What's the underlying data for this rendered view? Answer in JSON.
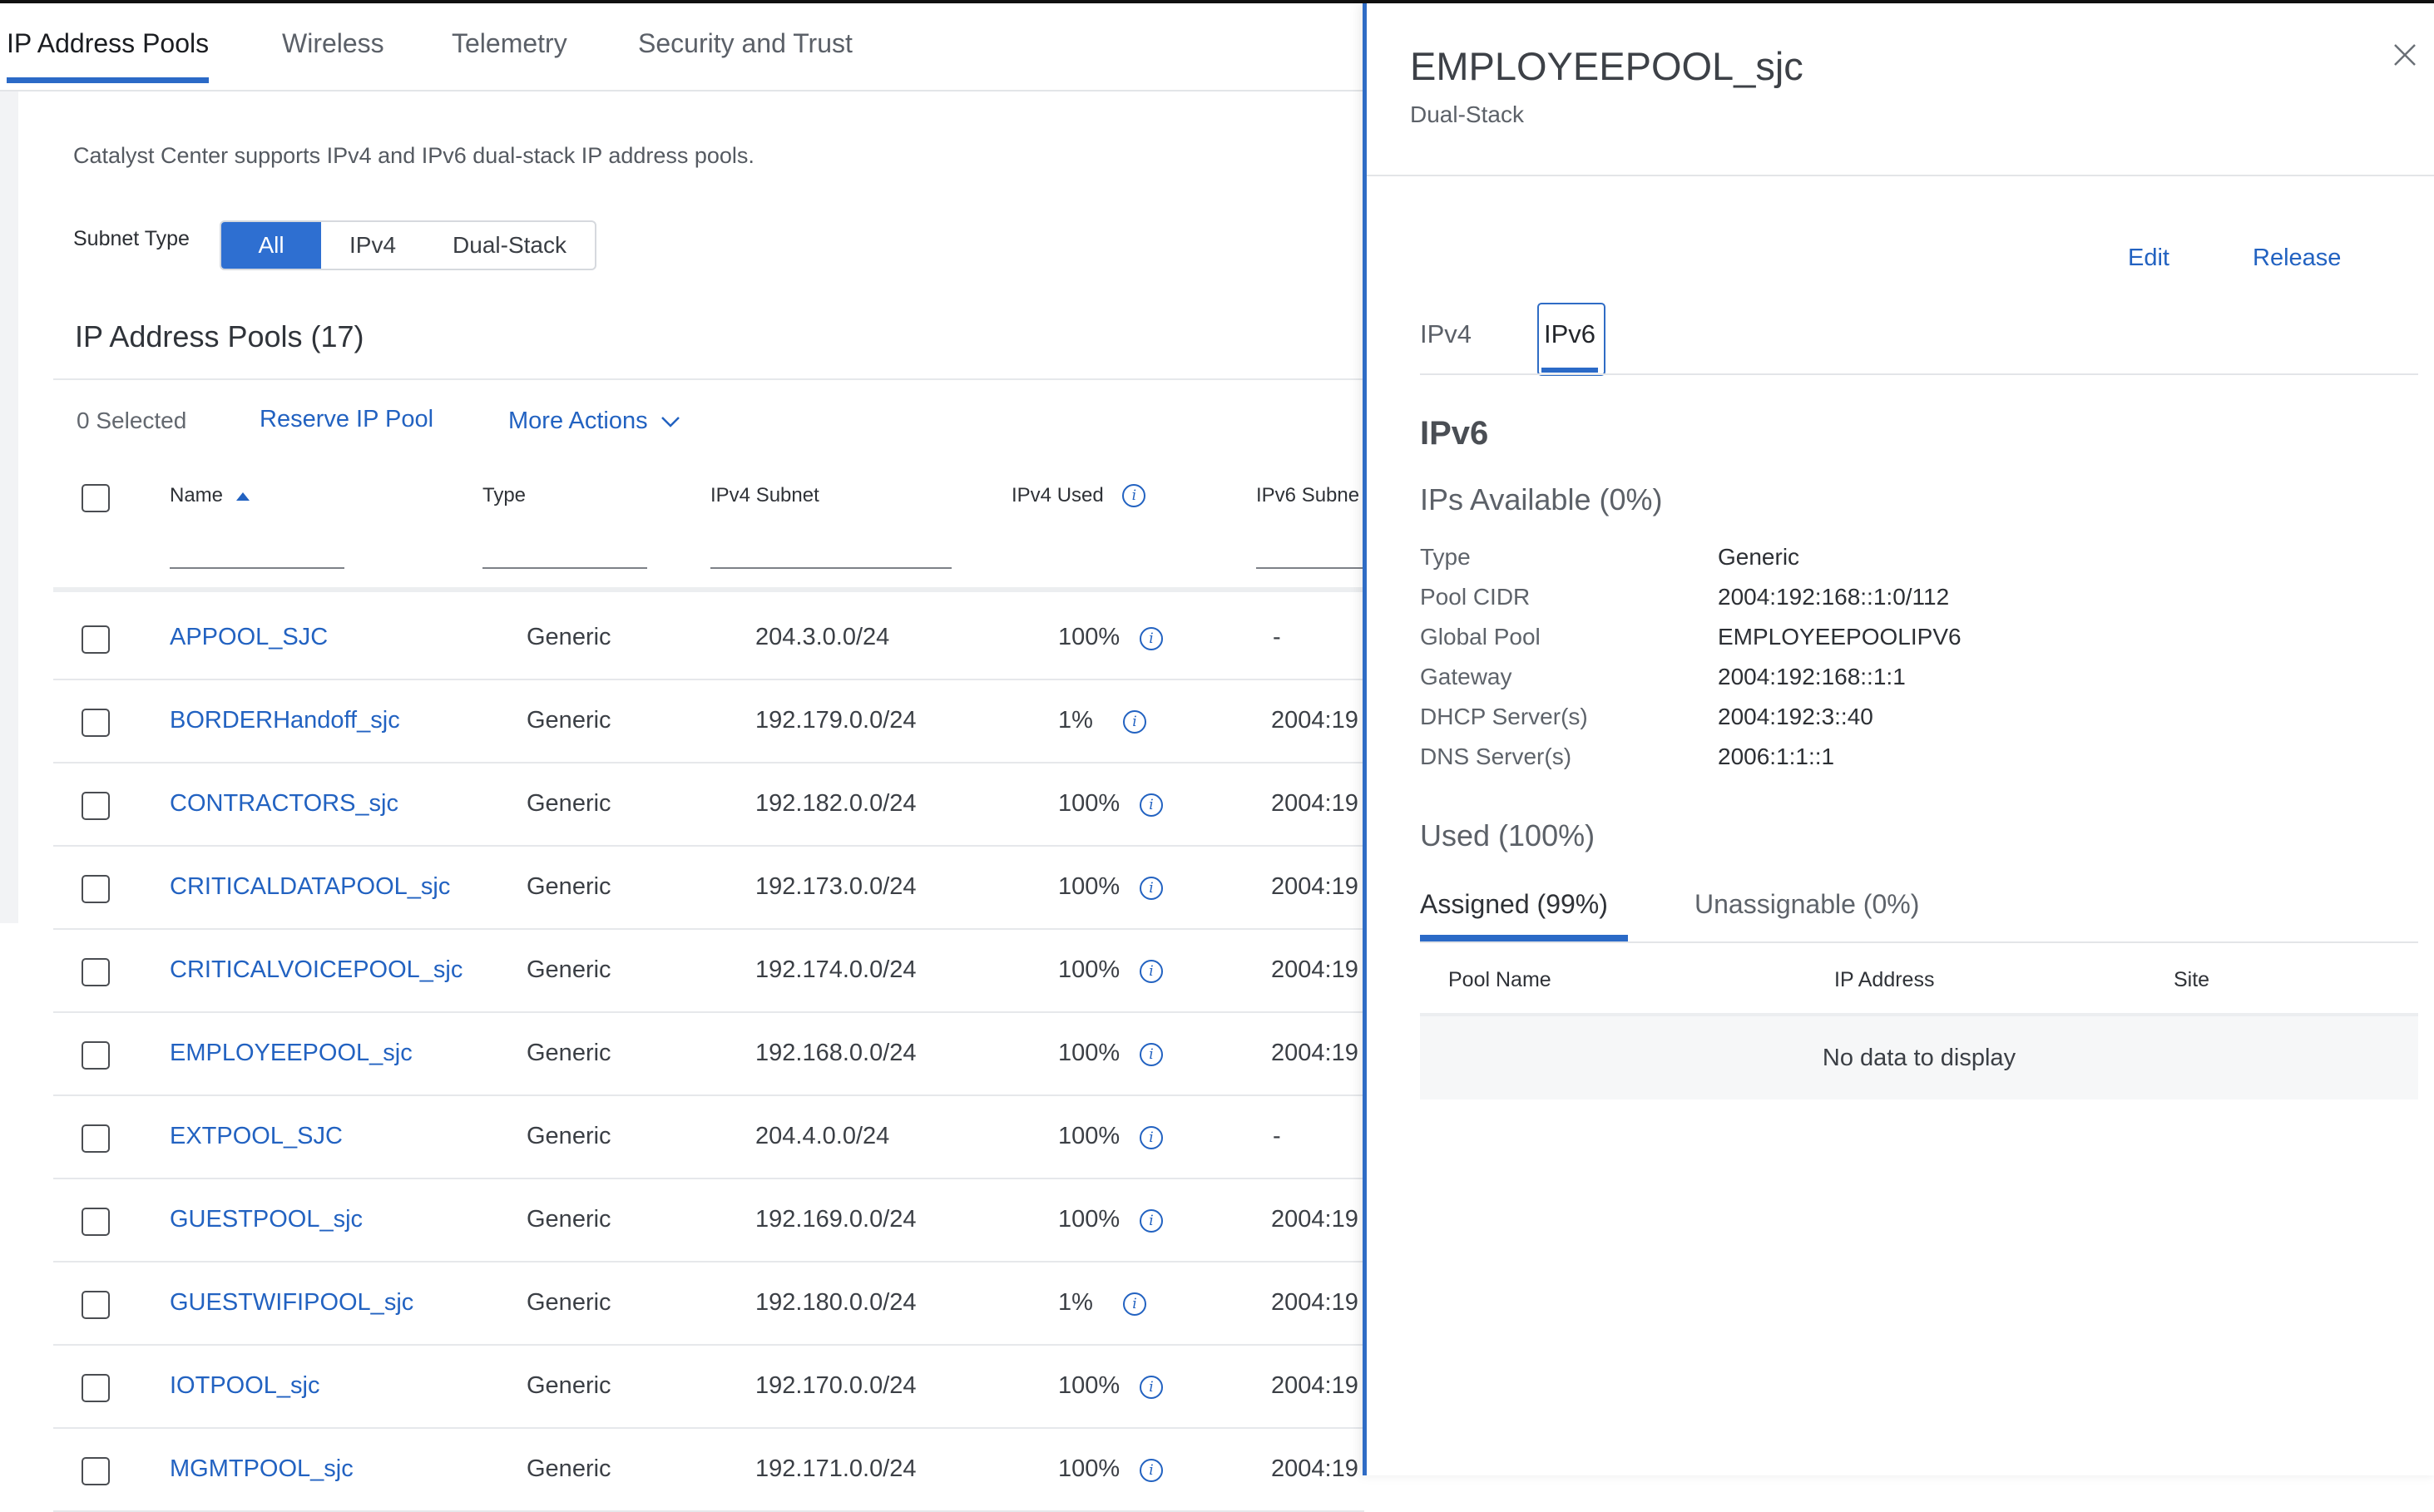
{
  "tabs": [
    "IP Address Pools",
    "Wireless",
    "Telemetry",
    "Security and Trust"
  ],
  "description": "Catalyst Center supports IPv4 and IPv6 dual-stack IP address pools.",
  "subnet_filter": {
    "label": "Subnet Type",
    "options": [
      "All",
      "IPv4",
      "Dual-Stack"
    ],
    "selected": "All"
  },
  "pools_title": "IP Address Pools (17)",
  "toolbar": {
    "selected": "0 Selected",
    "reserve": "Reserve IP Pool",
    "more_actions": "More Actions"
  },
  "columns": {
    "name": "Name",
    "type": "Type",
    "ipv4_subnet": "IPv4 Subnet",
    "ipv4_used": "IPv4 Used",
    "ipv6_subnet": "IPv6 Subne"
  },
  "rows": [
    {
      "name": "APPOOL_SJC",
      "type": "Generic",
      "ipv4_subnet": "204.3.0.0/24",
      "ipv4_used": "100%",
      "ipv6": "-"
    },
    {
      "name": "BORDERHandoff_sjc",
      "type": "Generic",
      "ipv4_subnet": "192.179.0.0/24",
      "ipv4_used": "1%",
      "ipv6": "2004:19"
    },
    {
      "name": "CONTRACTORS_sjc",
      "type": "Generic",
      "ipv4_subnet": "192.182.0.0/24",
      "ipv4_used": "100%",
      "ipv6": "2004:19"
    },
    {
      "name": "CRITICALDATAPOOL_sjc",
      "type": "Generic",
      "ipv4_subnet": "192.173.0.0/24",
      "ipv4_used": "100%",
      "ipv6": "2004:19"
    },
    {
      "name": "CRITICALVOICEPOOL_sjc",
      "type": "Generic",
      "ipv4_subnet": "192.174.0.0/24",
      "ipv4_used": "100%",
      "ipv6": "2004:19"
    },
    {
      "name": "EMPLOYEEPOOL_sjc",
      "type": "Generic",
      "ipv4_subnet": "192.168.0.0/24",
      "ipv4_used": "100%",
      "ipv6": "2004:19"
    },
    {
      "name": "EXTPOOL_SJC",
      "type": "Generic",
      "ipv4_subnet": "204.4.0.0/24",
      "ipv4_used": "100%",
      "ipv6": "-"
    },
    {
      "name": "GUESTPOOL_sjc",
      "type": "Generic",
      "ipv4_subnet": "192.169.0.0/24",
      "ipv4_used": "100%",
      "ipv6": "2004:19"
    },
    {
      "name": "GUESTWIFIPOOL_sjc",
      "type": "Generic",
      "ipv4_subnet": "192.180.0.0/24",
      "ipv4_used": "1%",
      "ipv6": "2004:19"
    },
    {
      "name": "IOTPOOL_sjc",
      "type": "Generic",
      "ipv4_subnet": "192.170.0.0/24",
      "ipv4_used": "100%",
      "ipv6": "2004:19"
    },
    {
      "name": "MGMTPOOL_sjc",
      "type": "Generic",
      "ipv4_subnet": "192.171.0.0/24",
      "ipv4_used": "100%",
      "ipv6": "2004:19"
    }
  ],
  "panel": {
    "title": "EMPLOYEEPOOL_sjc",
    "subtitle": "Dual-Stack",
    "edit": "Edit",
    "release": "Release",
    "tabs": [
      "IPv4",
      "IPv6"
    ],
    "active_tab": "IPv6",
    "section_title": "IPv6",
    "available": "IPs Available (0%)",
    "details": [
      {
        "key": "Type",
        "value": "Generic"
      },
      {
        "key": "Pool CIDR",
        "value": "2004:192:168::1:0/112"
      },
      {
        "key": "Global Pool",
        "value": "EMPLOYEEPOOLIPV6"
      },
      {
        "key": "Gateway",
        "value": "2004:192:168::1:1"
      },
      {
        "key": "DHCP Server(s)",
        "value": "2004:192:3::40"
      },
      {
        "key": "DNS Server(s)",
        "value": "2006:1:1::1"
      }
    ],
    "used": "Used (100%)",
    "sub_tabs": [
      "Assigned (99%)",
      "Unassignable (0%)"
    ],
    "grid_headers": [
      "Pool Name",
      "IP Address",
      "Site"
    ],
    "empty": "No data to display"
  },
  "colors": {
    "accent": "#2b6ac7",
    "link": "#2262c1",
    "segment_on": "#2e6fd1"
  }
}
